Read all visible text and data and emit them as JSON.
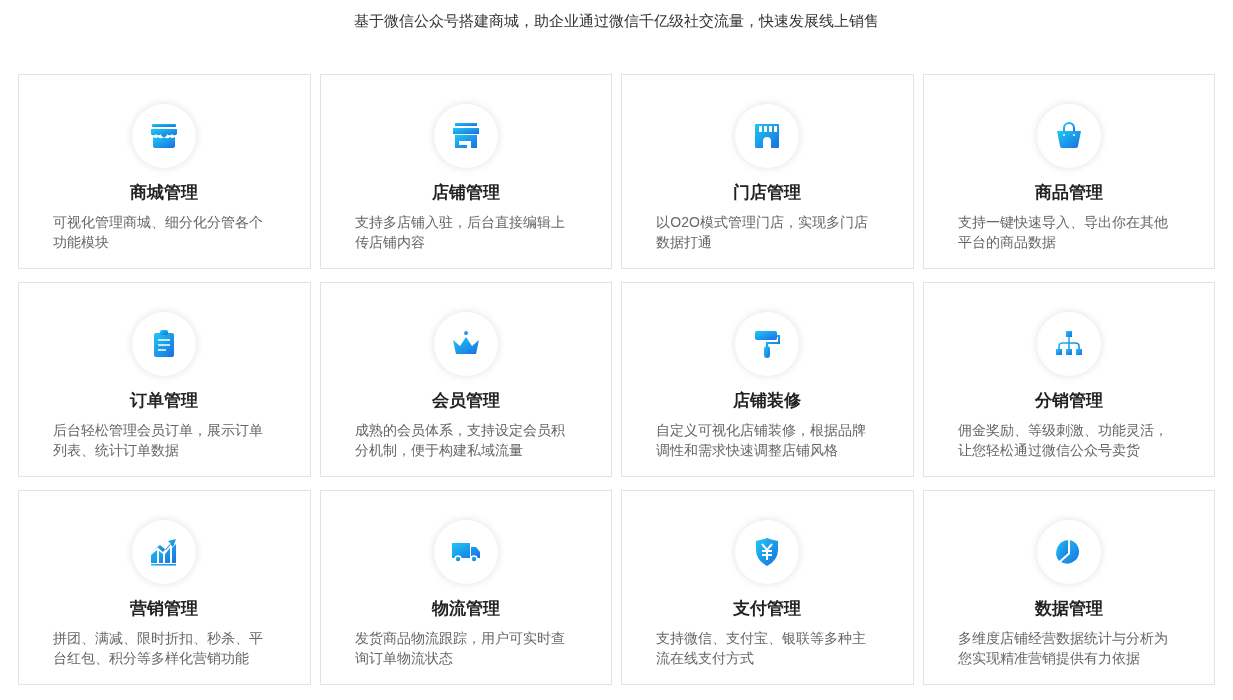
{
  "subtitle": "基于微信公众号搭建商城，助企业通过微信千亿级社交流量，快速发展线上销售",
  "features": [
    {
      "kind": "awning",
      "title": "商城管理",
      "description": "可视化管理商城、细分化分管各个功能模块"
    },
    {
      "kind": "shop",
      "title": "店铺管理",
      "description": "支持多店铺入驻，后台直接编辑上传店铺内容"
    },
    {
      "kind": "store",
      "title": "门店管理",
      "description": "以O2O模式管理门店，实现多门店数据打通"
    },
    {
      "kind": "bag",
      "title": "商品管理",
      "description": "支持一键快速导入、导出你在其他平台的商品数据"
    },
    {
      "kind": "clipboard",
      "title": "订单管理",
      "description": "后台轻松管理会员订单，展示订单列表、统计订单数据"
    },
    {
      "kind": "crown",
      "title": "会员管理",
      "description": "成熟的会员体系，支持设定会员积分机制，便于构建私域流量"
    },
    {
      "kind": "roller",
      "title": "店铺装修",
      "description": "自定义可视化店铺装修，根据品牌调性和需求快速调整店铺风格"
    },
    {
      "kind": "hierarchy",
      "title": "分销管理",
      "description": "佣金奖励、等级刺激、功能灵活，让您轻松通过微信公众号卖货"
    },
    {
      "kind": "chart",
      "title": "营销管理",
      "description": "拼团、满减、限时折扣、秒杀、平台红包、积分等多样化营销功能"
    },
    {
      "kind": "truck",
      "title": "物流管理",
      "description": "发货商品物流跟踪，用户可实时查询订单物流状态"
    },
    {
      "kind": "yuan",
      "title": "支付管理",
      "description": "支持微信、支付宝、银联等多种主流在线支付方式"
    },
    {
      "kind": "pie",
      "title": "数据管理",
      "description": "多维度店铺经营数据统计与分析为您实现精准营销提供有力依据"
    }
  ]
}
